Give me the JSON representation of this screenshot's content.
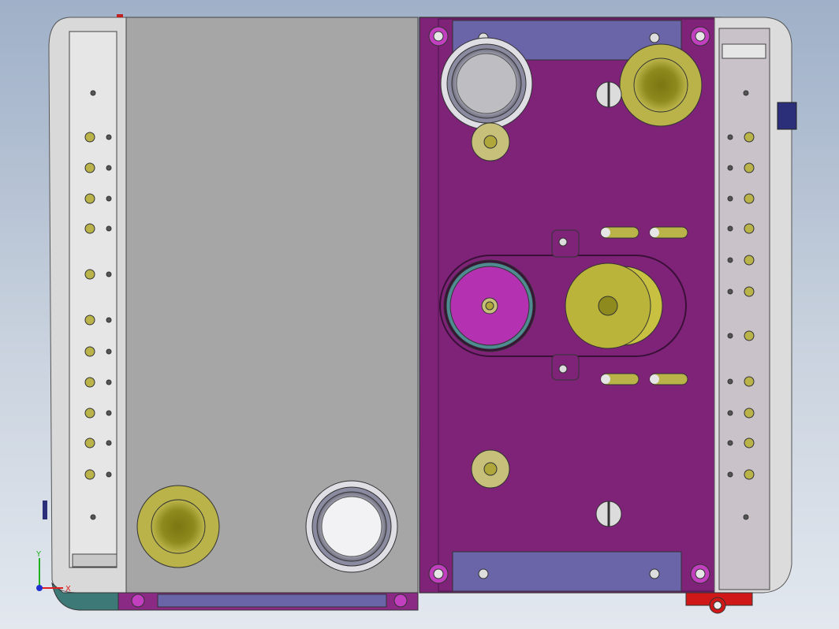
{
  "viewport": {
    "background_top": "#9fb0c8",
    "background_bottom": "#e3e8ef"
  },
  "triad": {
    "x_label": "X",
    "y_label": "Y",
    "x_color": "#e02020",
    "y_color": "#20b020",
    "z_color": "#2030d0"
  },
  "colors": {
    "housing_left": "#dcdcdc",
    "gray_cover": "#a8a8a8",
    "magenta_plate": "#7e2378",
    "brass": "#b8b245",
    "brass_dark": "#858016",
    "blue_bar": "#6a64a8",
    "teal_base": "#3d7a77",
    "red_bracket": "#d01818",
    "bright_magenta_gear": "#b432b2",
    "connector_strip": "#c9c3c9"
  },
  "model": {
    "left_connector_holes": 12,
    "right_connector_holes": 12
  }
}
